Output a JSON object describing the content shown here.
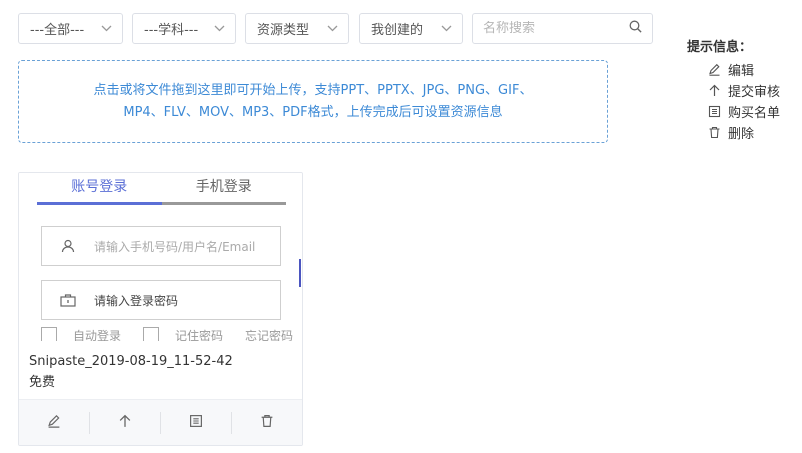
{
  "filters": {
    "all": "---全部---",
    "subject": "---学科---",
    "resource_type": "资源类型",
    "creator": "我创建的"
  },
  "search": {
    "placeholder": "名称搜索",
    "value": ""
  },
  "upload": {
    "line1": "点击或将文件拖到这里即可开始上传，支持PPT、PPTX、JPG、PNG、GIF、",
    "line2": "MP4、FLV、MOV、MP3、PDF格式，上传完成后可设置资源信息"
  },
  "hint": {
    "title": "提示信息：",
    "items": [
      "编辑",
      "提交审核",
      "购买名单",
      "删除"
    ]
  },
  "card": {
    "thumbnail": {
      "tab_account": "账号登录",
      "tab_phone": "手机登录",
      "username_placeholder": "请输入手机号码/用户名/Email",
      "password_placeholder": "请输入登录密码",
      "auto_login": "自动登录",
      "remember_password": "记住密码",
      "forgot_password": "忘记密码"
    },
    "name": "Snipaste_2019-08-19_11-52-42",
    "price": "免费"
  },
  "colors": {
    "accent": "#3d8ad6",
    "tab_active": "#5b6fd6",
    "border": "#dcdfe6"
  }
}
